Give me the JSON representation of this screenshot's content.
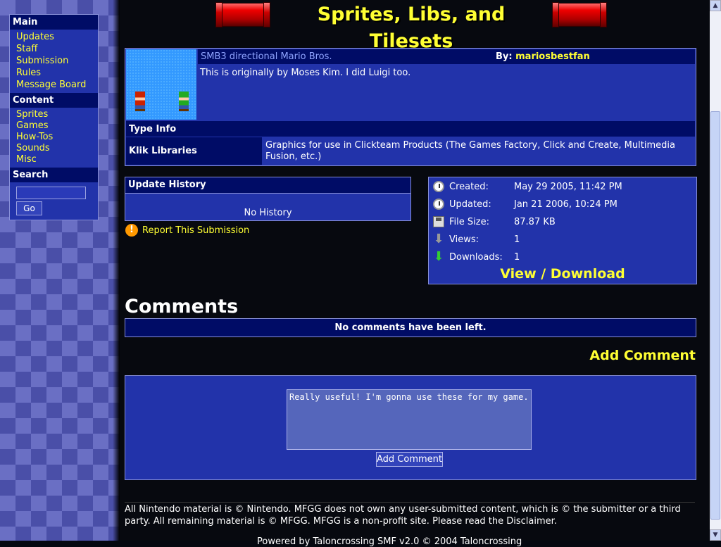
{
  "sidebar": {
    "main_heading": "Main",
    "main_links": [
      "Updates",
      "Staff",
      "Submission",
      "Rules",
      "Message Board"
    ],
    "content_heading": "Content",
    "content_links": [
      "Sprites",
      "Games",
      "How-Tos",
      "Sounds",
      "Misc"
    ],
    "search_heading": "Search",
    "search_value": "",
    "go_label": "Go"
  },
  "page_title": "Sprites, Libs, and Tilesets",
  "submission": {
    "name": "SMB3 directional Mario Bros.",
    "by_label": "By:",
    "author": "mariosbestfan",
    "description": "This is originally by Moses Kim. I did Luigi too.",
    "type_info_heading": "Type Info",
    "type_label": "Klik Libraries",
    "type_description": "Graphics for use in Clickteam Products (The Games Factory, Click and Create, Multimedia Fusion, etc.)"
  },
  "update_history": {
    "heading": "Update History",
    "empty_text": "No History"
  },
  "report_label": "Report This Submission",
  "info": {
    "created_label": "Created:",
    "created_value": "May 29 2005, 11:42 PM",
    "updated_label": "Updated:",
    "updated_value": "Jan 21 2006, 10:24 PM",
    "filesize_label": "File Size:",
    "filesize_value": "87.87 KB",
    "views_label": "Views:",
    "views_value": "1",
    "downloads_label": "Downloads:",
    "downloads_value": "1",
    "view_download_label": "View / Download"
  },
  "comments": {
    "heading": "Comments",
    "empty_text": "No comments have been left.",
    "add_comment_link": "Add Comment",
    "textarea_value": "Really useful! I'm gonna use these for my game.",
    "submit_label": "Add Comment"
  },
  "footer": {
    "text": "All Nintendo material is © Nintendo. MFGG does not own any user-submitted content, which is © the submitter or a third party. All remaining material is © MFGG. MFGG is a non-profit site. Please read the Disclaimer.",
    "partial_line": "Powered by Taloncrossing SMF v2.0 © 2004 Taloncrossing"
  },
  "colors": {
    "panel_bg": "#2233aa",
    "header_bg": "#000c66",
    "link_yellow": "#ffff33",
    "border": "#8890d8"
  }
}
